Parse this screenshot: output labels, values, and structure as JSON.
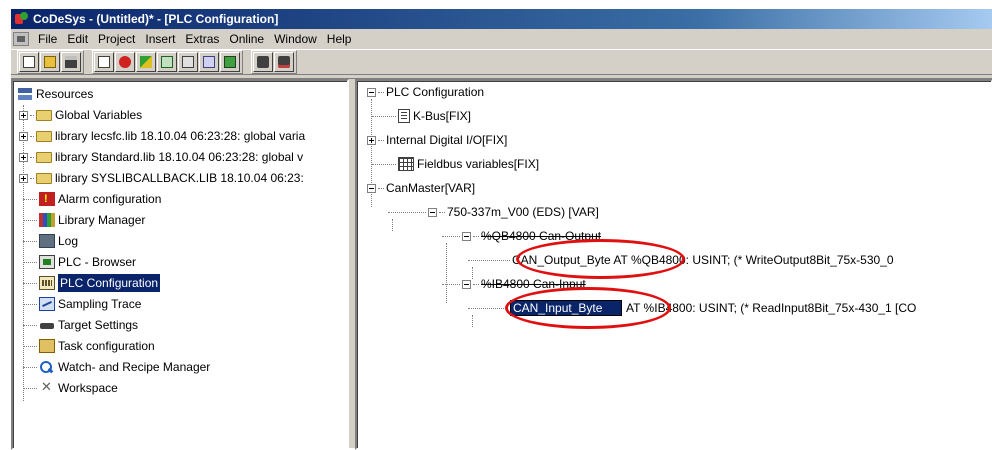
{
  "window": {
    "title": "CoDeSys - (Untitled)* - [PLC Configuration]"
  },
  "menubar": {
    "items": [
      "File",
      "Edit",
      "Project",
      "Insert",
      "Extras",
      "Online",
      "Window",
      "Help"
    ]
  },
  "toolbar": {
    "groups": [
      [
        "new-icon",
        "open-icon",
        "save-icon"
      ],
      [
        "build-icon",
        "stop-icon",
        "login-icon",
        "logout-icon",
        "run-icon",
        "step-icon",
        "breakpoint-icon"
      ],
      [
        "find-icon",
        "replace-icon"
      ]
    ]
  },
  "resources": {
    "root": "Resources",
    "items": [
      {
        "label": "Global Variables",
        "icon": "folder-icon",
        "expandable": true
      },
      {
        "label": "library lecsfc.lib 18.10.04 06:23:28: global varia",
        "icon": "folder-icon",
        "expandable": true
      },
      {
        "label": "library Standard.lib 18.10.04 06:23:28: global v",
        "icon": "folder-icon",
        "expandable": true
      },
      {
        "label": "library SYSLIBCALLBACK.LIB 18.10.04 06:23:",
        "icon": "folder-icon",
        "expandable": true
      },
      {
        "label": "Alarm configuration",
        "icon": "alarm-icon"
      },
      {
        "label": "Library Manager",
        "icon": "library-icon"
      },
      {
        "label": "Log",
        "icon": "log-icon"
      },
      {
        "label": "PLC - Browser",
        "icon": "browser-icon"
      },
      {
        "label": "PLC Configuration",
        "icon": "plc-config-icon",
        "selected": true
      },
      {
        "label": "Sampling Trace",
        "icon": "trace-icon"
      },
      {
        "label": "Target Settings",
        "icon": "target-icon"
      },
      {
        "label": "Task configuration",
        "icon": "task-icon"
      },
      {
        "label": "Watch- and Recipe Manager",
        "icon": "watch-icon"
      },
      {
        "label": "Workspace",
        "icon": "workspace-icon"
      }
    ]
  },
  "plc_config": {
    "root": "PLC Configuration",
    "kbus": "K-Bus[FIX]",
    "internal_io": "Internal Digital I/O[FIX]",
    "fieldbus": "Fieldbus variables[FIX]",
    "canmaster": "CanMaster[VAR]",
    "module": "750-337m_V00 (EDS)  [VAR]",
    "output_group": "%QB4800 Can-Output",
    "output_var": "CAN_Output_Byte AT %QB4800: USINT; (* WriteOutput8Bit_75x-530_0",
    "input_group": "%IB4800 Can-Input",
    "input_var_edit": "CAN_Input_Byte",
    "input_var_rest": "AT %IB4800: USINT; (* ReadInput8Bit_75x-430_1 [CO"
  }
}
